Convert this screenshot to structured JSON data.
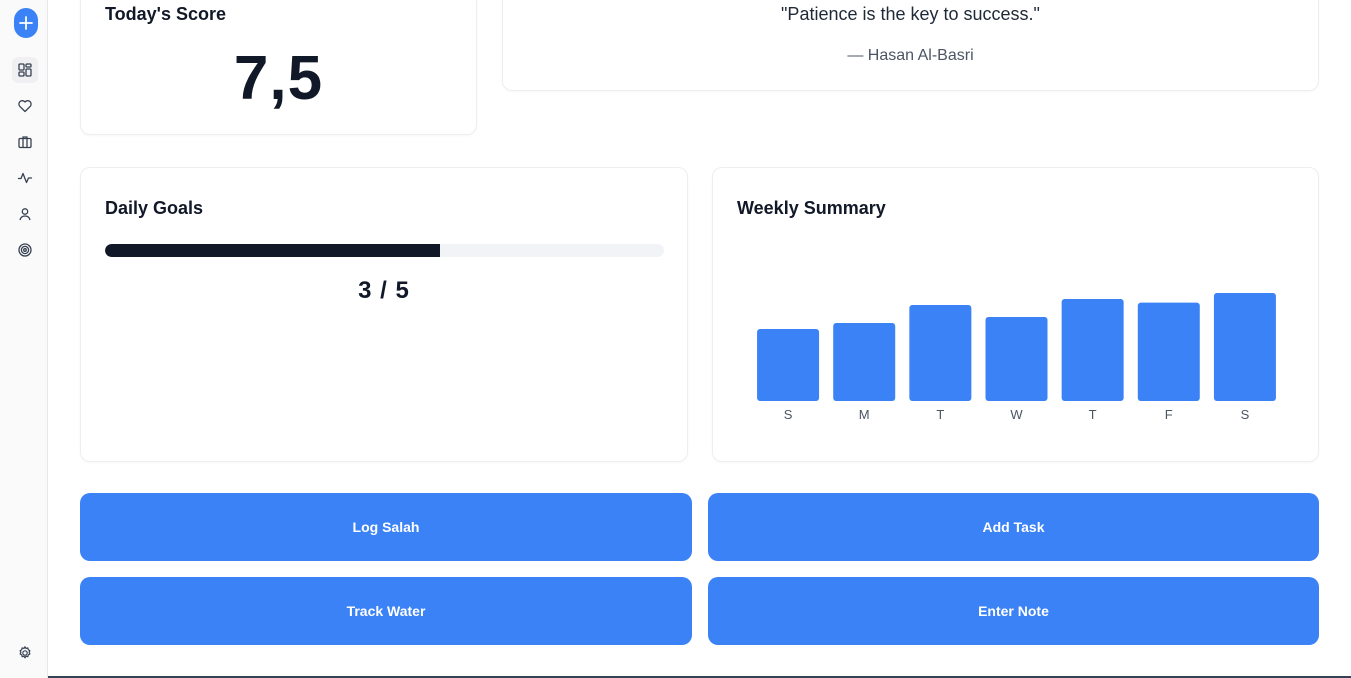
{
  "sidebar": {
    "add_icon": "plus-icon",
    "items": [
      {
        "name": "dashboard",
        "icon": "grid-icon",
        "active": true
      },
      {
        "name": "health",
        "icon": "heart-icon",
        "active": false
      },
      {
        "name": "work",
        "icon": "briefcase-icon",
        "active": false
      },
      {
        "name": "activity",
        "icon": "activity-icon",
        "active": false
      },
      {
        "name": "profile",
        "icon": "user-icon",
        "active": false
      },
      {
        "name": "goals",
        "icon": "target-icon",
        "active": false
      }
    ],
    "settings_icon": "gear-icon"
  },
  "score": {
    "title": "Today's Score",
    "value": "7,5"
  },
  "quote": {
    "text": "\"Patience is the key to success.\"",
    "author": "— Hasan Al-Basri"
  },
  "goals": {
    "title": "Daily Goals",
    "completed": 3,
    "total": 5,
    "label": "3 / 5"
  },
  "weekly": {
    "title": "Weekly Summary"
  },
  "chart_data": {
    "type": "bar",
    "title": "Weekly Summary",
    "categories": [
      "S",
      "M",
      "T",
      "W",
      "T",
      "F",
      "S"
    ],
    "values": [
      6.0,
      6.5,
      8.0,
      7.0,
      8.5,
      8.2,
      9.0
    ],
    "ylim": [
      0,
      10
    ],
    "grid": false,
    "color": "#3b82f6"
  },
  "actions": {
    "log_salah": "Log Salah",
    "add_task": "Add Task",
    "track_water": "Track Water",
    "enter_note": "Enter Note"
  },
  "colors": {
    "accent": "#3b82f6",
    "progress": "#111827",
    "track": "#f1f3f7"
  }
}
